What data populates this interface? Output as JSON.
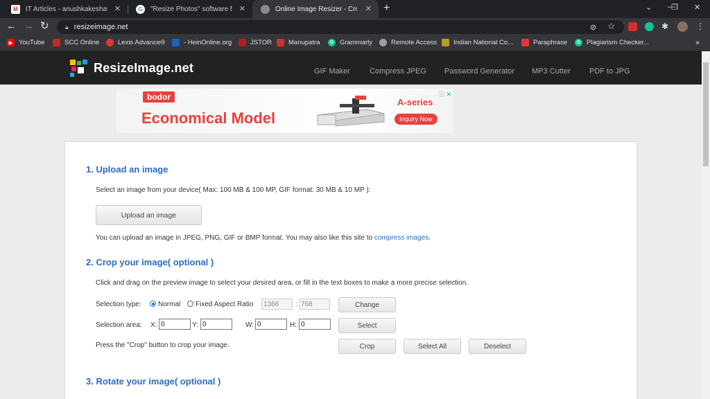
{
  "tabs": [
    {
      "title": "IT Articles - anushkakeshavsharma",
      "icon": "gmail-icon"
    },
    {
      "title": "\"Resize Photos\" software for com",
      "icon": "google-icon"
    },
    {
      "title": "Online Image Resizer - Crop, Resiz",
      "icon": "globe-icon"
    }
  ],
  "address_bar": {
    "url": "resizeimage.net"
  },
  "bookmarks": [
    {
      "label": "YouTube",
      "icon": "youtube-icon",
      "color": "#ff0000"
    },
    {
      "label": "SCC Online",
      "icon": "scc-icon",
      "color": "#c62828"
    },
    {
      "label": "Lexis Advance®",
      "icon": "lexis-icon",
      "color": "#e53935"
    },
    {
      "label": "- HeinOnline.org",
      "icon": "hein-icon",
      "color": "#1565c0"
    },
    {
      "label": "JSTOR",
      "icon": "jstor-icon",
      "color": "#b71c1c"
    },
    {
      "label": "Manupatra",
      "icon": "manupatra-icon",
      "color": "#d32f2f"
    },
    {
      "label": "Grammarly",
      "icon": "grammarly-icon",
      "color": "#15c39a"
    },
    {
      "label": "Remote Access",
      "icon": "globe-icon",
      "color": "#9e9e9e"
    },
    {
      "label": "Indian National Co...",
      "icon": "inc-icon",
      "color": "#b59b2b"
    },
    {
      "label": "Paraphrase",
      "icon": "paraphrase-icon",
      "color": "#e53935"
    },
    {
      "label": "Plagiarism Checker...",
      "icon": "grammarly-icon",
      "color": "#15c39a"
    }
  ],
  "site": {
    "logo": "ResizeImage.net",
    "nav": [
      "GIF Maker",
      "Compress JPEG",
      "Password Generator",
      "MP3 Cutter",
      "PDF to JPG"
    ]
  },
  "ad": {
    "brand": "bodor",
    "headline": "Economical Model",
    "series": "A-series",
    "cta": "Inquiry Now"
  },
  "section1": {
    "title": "1. Upload an image",
    "desc": "Select an image from your device( Max: 100 MB & 100 MP, GIF format: 30 MB & 10 MP ):",
    "upload_button": "Upload an image",
    "note": "You can upload an image in JPEG, PNG, GIF or BMP format. You may also like this site to",
    "note_link": "compress images",
    "note_end": "."
  },
  "section2": {
    "title": "2. Crop your image( optional )",
    "desc": "Click and drag on the preview image to select your desired area, or fill in the text boxes to make a more precise selection.",
    "selection_type_label": "Selection type:",
    "normal_label": "Normal",
    "fixed_label": "Fixed Aspect Ratio",
    "ratio_w": "1366",
    "ratio_sep": ":",
    "ratio_h": "768",
    "change_button": "Change",
    "selection_area_label": "Selection area:",
    "x_label": "X:",
    "x_value": "0",
    "y_label": "Y:",
    "y_value": "0",
    "w_label": "W:",
    "w_value": "0",
    "h_label": "H:",
    "h_value": "0",
    "select_button": "Select",
    "crop_note": "Press the \"Crop\" button to crop your image.",
    "crop_button": "Crop",
    "select_all_button": "Select All",
    "deselect_button": "Deselect"
  },
  "section3": {
    "title": "3. Rotate your image( optional )"
  }
}
